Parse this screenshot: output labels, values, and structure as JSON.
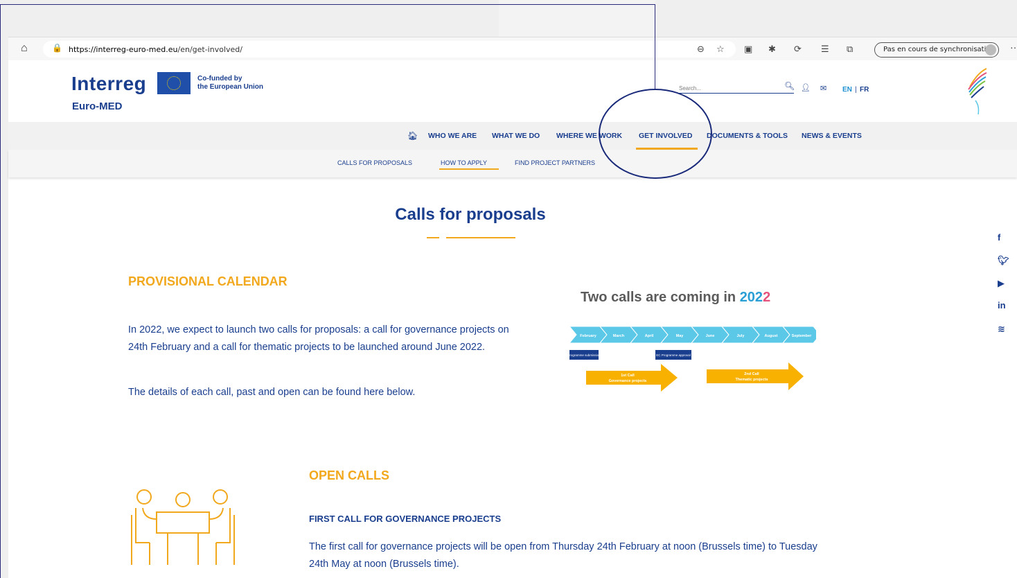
{
  "browser": {
    "url_host": "https://interreg-euro-med.eu",
    "url_path": "/en/get-involved/",
    "sync_label": "Pas en cours de synchronisation",
    "more_label": "···"
  },
  "header": {
    "logo_main": "Interreg",
    "logo_sub": "Euro-MED",
    "cofunded_line1": "Co-funded by",
    "cofunded_line2": "the European Union",
    "search_placeholder": "Search...",
    "lang_en": "EN",
    "lang_sep": "|",
    "lang_fr": "FR"
  },
  "nav": {
    "items": [
      "WHO WE ARE",
      "WHAT WE DO",
      "WHERE WE WORK",
      "GET INVOLVED",
      "DOCUMENTS & TOOLS",
      "NEWS & EVENTS"
    ],
    "active": "GET INVOLVED"
  },
  "subnav": {
    "items": [
      "CALLS FOR PROPOSALS",
      "HOW TO APPLY",
      "FIND PROJECT PARTNERS"
    ],
    "active": "HOW TO APPLY"
  },
  "main": {
    "title": "Calls for proposals",
    "calendar_heading": "PROVISIONAL CALENDAR",
    "calendar_p1": "In 2022, we expect to launch two calls for proposals: a call for governance projects on 24th February and a call for thematic projects to be launched around June 2022.",
    "calendar_p2": "The details of each call, past and open can be found here below.",
    "open_calls_heading": "OPEN CALLS",
    "first_call_heading": "FIRST CALL FOR GOVERNANCE PROJECTS",
    "first_call_text": "The first call for governance projects will be open from Thursday 24th February at noon (Brussels time) to Tuesday 24th May at noon (Brussels time)."
  },
  "calendar_graphic": {
    "title_prefix": "Two calls are coming in ",
    "year_part1": "202",
    "year_part2": "2",
    "months": [
      "February",
      "March",
      "April",
      "May",
      "June",
      "July",
      "August",
      "September"
    ],
    "box1": "Programme submission",
    "box2": "EC Programme approval",
    "arrow1_line1": "1st Call",
    "arrow1_line2": "Governance projects",
    "arrow2_line1": "2nd Call",
    "arrow2_line2": "Thematic projects",
    "colors": {
      "month": "#5bc8e8",
      "box": "#1a3e8e",
      "arrow": "#f8b100"
    }
  },
  "social": [
    "f",
    "twitter",
    "youtube",
    "in",
    "rss"
  ]
}
